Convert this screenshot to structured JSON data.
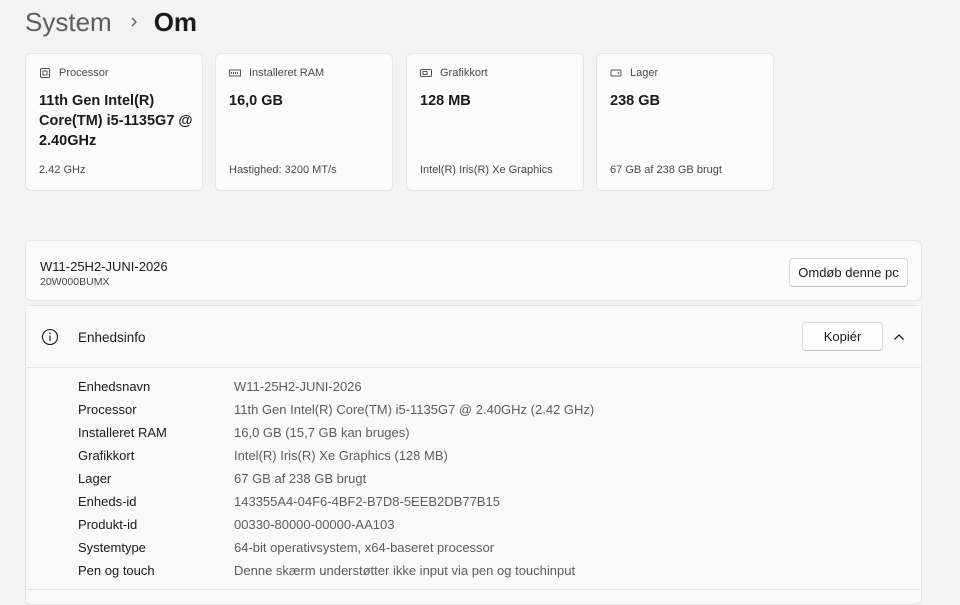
{
  "breadcrumb": {
    "parent": "System",
    "current": "Om"
  },
  "specs": [
    {
      "icon": "processor-icon",
      "label": "Processor",
      "value": "11th Gen Intel(R) Core(TM) i5-1135G7 @ 2.40GHz",
      "sub": "2.42 GHz"
    },
    {
      "icon": "ram-icon",
      "label": "Installeret RAM",
      "value": "16,0 GB",
      "sub": "Hastighed: 3200 MT/s"
    },
    {
      "icon": "graphics-card-icon",
      "label": "Grafikkort",
      "value": "128 MB",
      "sub": "Intel(R) Iris(R) Xe Graphics"
    },
    {
      "icon": "storage-icon",
      "label": "Lager",
      "value": "238 GB",
      "sub": "67 GB af 238 GB brugt"
    }
  ],
  "pc": {
    "name": "W11-25H2-JUNI-2026",
    "model": "20W000BUMX",
    "rename_label": "Omdøb denne pc"
  },
  "device_info": {
    "title": "Enhedsinfo",
    "copy_label": "Kopiér",
    "rows": [
      {
        "label": "Enhedsnavn",
        "value": "W11-25H2-JUNI-2026"
      },
      {
        "label": "Processor",
        "value": "11th Gen Intel(R) Core(TM) i5-1135G7 @ 2.40GHz (2.42 GHz)"
      },
      {
        "label": "Installeret RAM",
        "value": "16,0 GB (15,7 GB kan bruges)"
      },
      {
        "label": "Grafikkort",
        "value": "Intel(R) Iris(R) Xe Graphics (128 MB)"
      },
      {
        "label": "Lager",
        "value": "67 GB af 238 GB brugt"
      },
      {
        "label": "Enheds-id",
        "value": "143355A4-04F6-4BF2-B7D8-5EEB2DB77B15"
      },
      {
        "label": "Produkt-id",
        "value": "00330-80000-00000-AA103"
      },
      {
        "label": "Systemtype",
        "value": "64-bit operativsystem, x64-baseret processor"
      },
      {
        "label": "Pen og touch",
        "value": "Denne skærm understøtter ikke input via pen og touchinput"
      }
    ]
  }
}
